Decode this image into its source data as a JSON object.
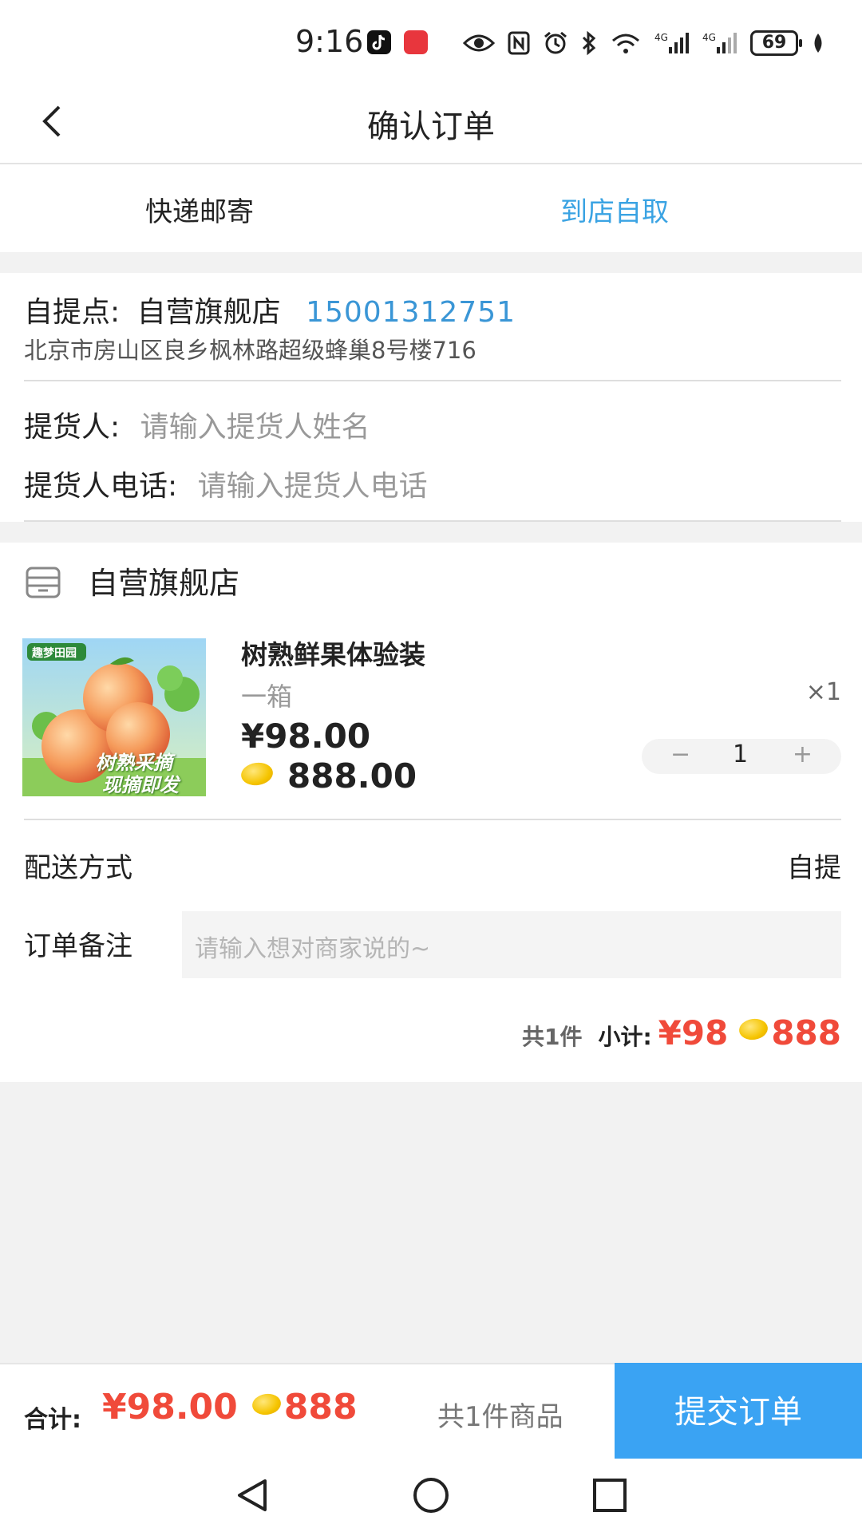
{
  "status_bar": {
    "time": "9:16",
    "battery": "69",
    "icons": [
      "tiktok-icon",
      "huawei-app-icon",
      "eye-icon",
      "nfc-icon",
      "alarm-icon",
      "bluetooth-icon",
      "wifi-icon",
      "signal-4g-icon",
      "signal-4g-icon",
      "battery-icon",
      "leaf-icon"
    ]
  },
  "header": {
    "title": "确认订单"
  },
  "delivery_tabs": {
    "tabs": [
      {
        "label": "快递邮寄",
        "active": false
      },
      {
        "label": "到店自取",
        "active": true
      }
    ],
    "active_color": "#3aa3e3"
  },
  "pickup": {
    "label": "自提点:",
    "store": "自营旗舰店",
    "phone": "15001312751",
    "address": "北京市房山区良乡枫林路超级蜂巢8号楼716",
    "receiver_label": "提货人:",
    "receiver_placeholder": "请输入提货人姓名",
    "receiver_phone_label": "提货人电话:",
    "receiver_phone_placeholder": "请输入提货人电话"
  },
  "store": {
    "name": "自营旗舰店",
    "item": {
      "title": "树熟鲜果体验装",
      "spec": "一箱",
      "qty_mark": "×1",
      "price": "¥98.00",
      "coin_price": "888.00",
      "image_brand": "趣梦田园",
      "image_caption_1": "树熟采摘",
      "image_caption_2": "现摘即发",
      "quantity": "1",
      "minus": "−",
      "plus": "+"
    },
    "delivery_label": "配送方式",
    "delivery_value": "自提",
    "note_label": "订单备注",
    "note_placeholder": "请输入想对商家说的~",
    "subtotal_count": "共1件",
    "subtotal_label": "小计:",
    "subtotal_price": "¥98",
    "subtotal_coin": "888"
  },
  "bottom_bar": {
    "total_label": "合计:",
    "total_price": "¥98.00",
    "total_coin": "888",
    "total_count": "共1件商品",
    "submit_label": "提交订单"
  },
  "colors": {
    "price": "#f04a3a",
    "accent": "#3aa3e3",
    "submit_bg": "#3aa3f3"
  }
}
